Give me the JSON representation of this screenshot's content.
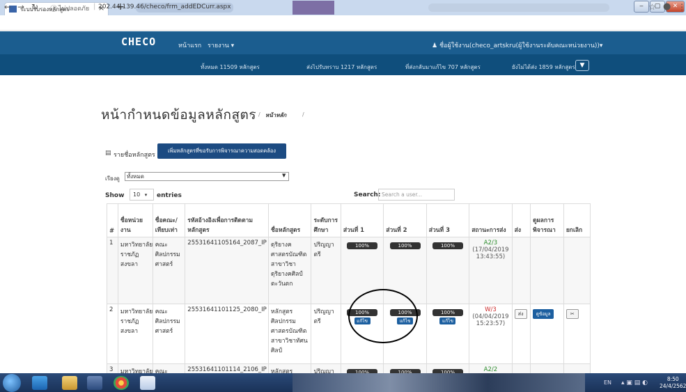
{
  "browser": {
    "tab_title": "ระบบรับรองหลักสูตร",
    "tab_close": "×",
    "new_tab": "+",
    "address_insecure": "ไม่ปลอดภัย",
    "url": "202.44.139.46/checo/frm_addEDCurr.aspx"
  },
  "site": {
    "logo": "CHECO",
    "nav": {
      "home": "หน้าแรก",
      "reports": "รายงาน ▾"
    },
    "user_menu": "ชื่อผู้ใช้งาน(checo_artskru(ผู้ใช้งานระดับคณะหน่วยงาน))▾",
    "stats": {
      "total": "ทั้งหมด 11509 หลักสูตร",
      "received": "ส่งไปรับทราบ 1217 หลักสูตร",
      "returned": "ที่ส่งกลับมาแก้ไข 707 หลักสูตร",
      "not_sent": "ยังไม่ได้ส่ง 1859 หลักสูตร"
    }
  },
  "page": {
    "title": "หน้ากำหนดข้อมูลหลักสูตร",
    "breadcrumb_sep": "/",
    "breadcrumb": "หน้าหลัก",
    "list_title": "รายชื่อหลักสูตร",
    "add_button": "เพิ่มหลักสูตรที่ขอรับการพิจารณาความสอดคล้อง",
    "sort_label": "เรียงดู",
    "sort_value": "ทั้งหมด",
    "show_label": "Show",
    "entries_value": "10",
    "entries_label": "entries",
    "search_label": "Search:",
    "search_placeholder": "Search a user..."
  },
  "table": {
    "headers": [
      "#",
      "ชื่อหน่วยงาน",
      "ชื่อคณะ/เทียบเท่า",
      "รหัสอ้างอิงเพื่อการติดตามหลักสูตร",
      "ชื่อหลักสูตร",
      "ระดับการศึกษา",
      "ส่วนที่ 1",
      "ส่วนที่ 2",
      "ส่วนที่ 3",
      "สถานะการส่ง",
      "ส่ง",
      "ดูผลการพิจารณา",
      "ยกเลิก"
    ],
    "rows": [
      {
        "num": "1",
        "org": "มหาวิทยาลัยราชภัฏสงขลา",
        "faculty": "คณะศิลปกรรมศาสตร์",
        "code": "25531641105164_2087_IP",
        "name": "ดุริยางคศาสตรบัณฑิต สาขาวิชาดุริยางคศิลป์ตะวันตก",
        "level": "ปริญญาตรี",
        "p1": "100%",
        "p2": "100%",
        "p3": "100%",
        "status": "A2/3",
        "date": "(17/04/2019 13:43:55)"
      },
      {
        "num": "2",
        "org": "มหาวิทยาลัยราชภัฏสงขลา",
        "faculty": "คณะศิลปกรรมศาสตร์",
        "code": "25531641101125_2080_IP",
        "name": "หลักสูตรศิลปกรรมศาสตรบัณฑิต สาขาวิชาทัศนศิลป์",
        "level": "ปริญญาตรี",
        "p1": "100%",
        "p2": "100%",
        "p3": "100%",
        "edit": "แก้ไข",
        "status": "W/3",
        "date": "(04/04/2019 15:23:57)",
        "send": "ส่ง",
        "view": "ดูข้อมูล",
        "cancel": "✂"
      },
      {
        "num": "3",
        "org": "มหาวิทยาลัย",
        "faculty": "คณะ",
        "code": "25531641101114_2106_IP",
        "name": "หลักสูตร",
        "level": "ปริญญา",
        "p1": "100%",
        "p2": "100%",
        "p3": "100%",
        "status": "A2/2"
      }
    ]
  },
  "taskbar": {
    "lang": "EN",
    "time": "8:50",
    "date": "24/4/2562"
  },
  "colors": {
    "navbar": "#1b5d8f",
    "navbar2": "#0f4e7c",
    "accent": "#1c5fa0",
    "ok": "#2a8a2a",
    "warn": "#cc2b2b"
  }
}
